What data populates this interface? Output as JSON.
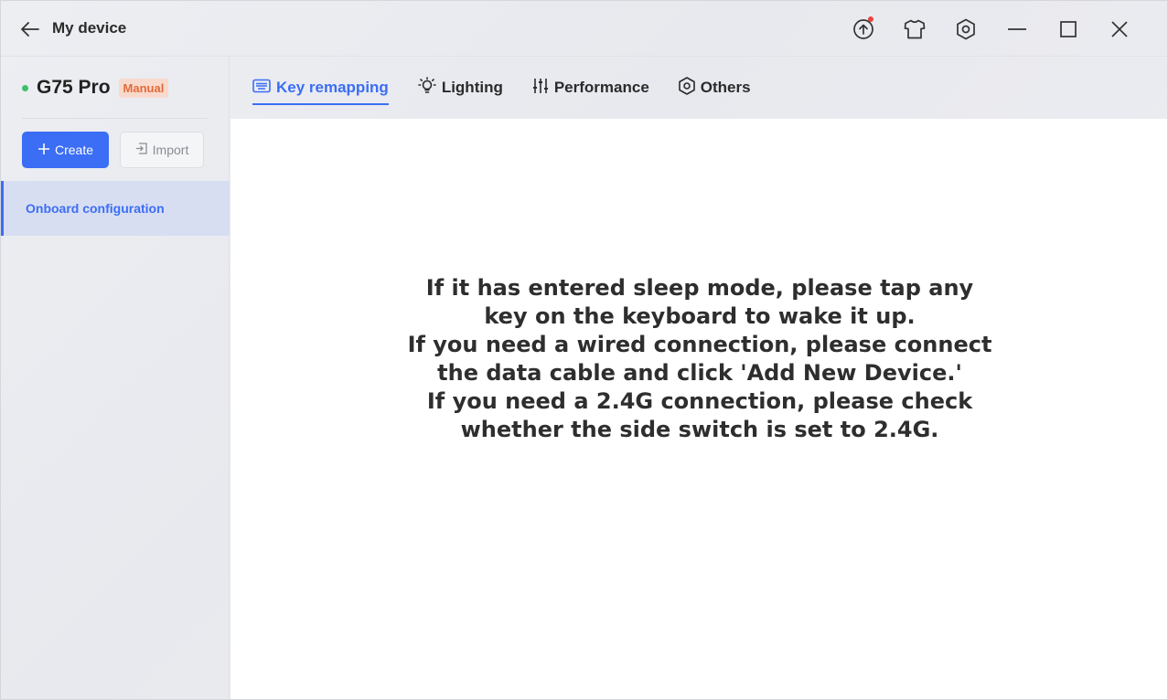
{
  "titlebar": {
    "title": "My device",
    "icons": [
      "upgrade-icon",
      "theme-icon",
      "settings-icon",
      "minimize-icon",
      "maximize-icon",
      "close-icon"
    ]
  },
  "sidebar": {
    "device_name": "G75 Pro",
    "mode_badge": "Manual",
    "status_color": "#3fbf6a",
    "create_label": "Create",
    "import_label": "Import",
    "items": [
      {
        "label": "Onboard configuration",
        "selected": true
      }
    ]
  },
  "tabs": [
    {
      "label": "Key remapping",
      "icon": "keyboard-icon",
      "active": true
    },
    {
      "label": "Lighting",
      "icon": "bulb-icon",
      "active": false
    },
    {
      "label": "Performance",
      "icon": "sliders-icon",
      "active": false
    },
    {
      "label": "Others",
      "icon": "hexagon-icon",
      "active": false
    }
  ],
  "main": {
    "message_lines": [
      "If it has entered sleep mode, please tap any",
      "key on the keyboard to wake it up.",
      "If you need a wired connection, please connect",
      "the data cable and click 'Add New Device.'",
      "If you need a 2.4G connection, please check",
      "whether the side switch is set to 2.4G."
    ]
  },
  "colors": {
    "accent": "#3b6ef5",
    "badge_text": "#e26a3c",
    "badge_bg": "#f8d9cc",
    "notification": "#e8453c"
  }
}
